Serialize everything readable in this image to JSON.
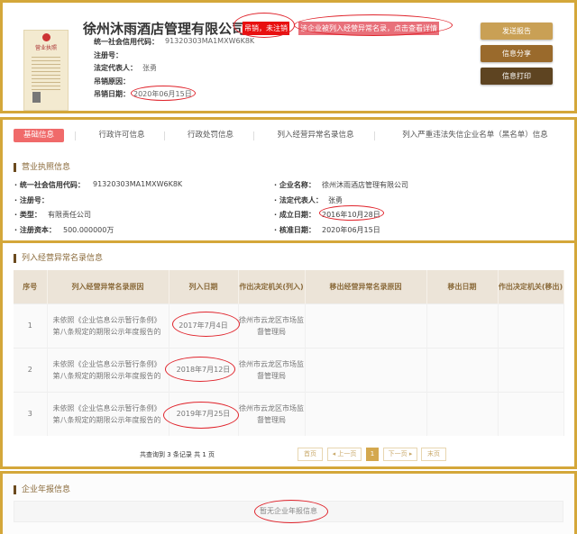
{
  "header": {
    "company_name": "徐州沐雨酒店管理有限公司",
    "status_badge": "吊销，未注销",
    "abnormal_notice": "该企业被列入经营异常名录，点击查看详情",
    "fields": [
      {
        "label": "统一社会信用代码：",
        "value": "91320303MA1MXW6K8K"
      },
      {
        "label": "注册号：",
        "value": ""
      },
      {
        "label": "法定代表人：",
        "value": "张勇"
      },
      {
        "label": "吊销原因：",
        "value": ""
      },
      {
        "label": "吊销日期：",
        "value": "2020年06月15日"
      }
    ],
    "buttons": {
      "report": "发送报告",
      "share": "信息分享",
      "print": "信息打印"
    },
    "license_image": {
      "title": "营业执照"
    }
  },
  "tabs": [
    {
      "label": "基础信息",
      "active": true
    },
    {
      "label": "行政许可信息"
    },
    {
      "label": "行政处罚信息"
    },
    {
      "label": "列入经营异常名录信息"
    },
    {
      "label": "列入严重违法失信企业名单（黑名单）信息"
    }
  ],
  "license": {
    "title": "营业执照信息",
    "left": [
      {
        "label": "统一社会信用代码：",
        "value": "91320303MA1MXW6K8K"
      },
      {
        "label": "注册号：",
        "value": ""
      },
      {
        "label": "类型：",
        "value": "有限责任公司"
      },
      {
        "label": "注册资本：",
        "value": "500.000000万"
      }
    ],
    "right": [
      {
        "label": "企业名称：",
        "value": "徐州沐雨酒店管理有限公司"
      },
      {
        "label": "法定代表人：",
        "value": "张勇"
      },
      {
        "label": "成立日期：",
        "value": "2016年10月28日"
      },
      {
        "label": "核准日期：",
        "value": "2020年06月15日"
      }
    ]
  },
  "abnormal": {
    "title": "列入经营异常名录信息",
    "columns": [
      "序号",
      "列入经营异常名录原因",
      "列入日期",
      "作出决定机关(列入)",
      "移出经营异常名录原因",
      "移出日期",
      "作出决定机关(移出)"
    ],
    "rows": [
      [
        "1",
        "未依照《企业信息公示暂行条例》第八条规定的期限公示年度报告的",
        "2017年7月4日",
        "徐州市云龙区市场监督管理局",
        "",
        "",
        ""
      ],
      [
        "2",
        "未依照《企业信息公示暂行条例》第八条规定的期限公示年度报告的",
        "2018年7月12日",
        "徐州市云龙区市场监督管理局",
        "",
        "",
        ""
      ],
      [
        "3",
        "未依照《企业信息公示暂行条例》第八条规定的期限公示年度报告的",
        "2019年7月25日",
        "徐州市云龙区市场监督管理局",
        "",
        "",
        ""
      ]
    ],
    "summary": "共查询到 3 条记录 共 1 页",
    "pager": {
      "first": "首页",
      "prev": "◂ 上一页",
      "current": "1",
      "next": "下一页 ▸",
      "last": "末页"
    }
  },
  "annual": {
    "title": "企业年报信息",
    "empty": "暂无企业年报信息"
  },
  "colors": {
    "gold": "#d4a73a",
    "badge_red": "#e81010",
    "tab_active": "#f06a6a"
  }
}
